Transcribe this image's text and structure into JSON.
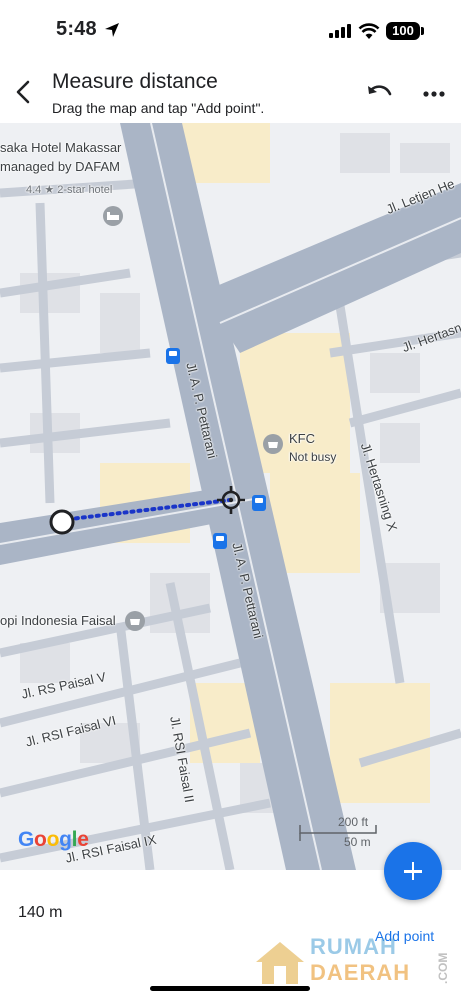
{
  "status_bar": {
    "time": "5:48",
    "battery": "100"
  },
  "header": {
    "title": "Measure distance",
    "subtitle": "Drag the map and tap \"Add point\"."
  },
  "map": {
    "labels": {
      "hotel_line1": "saka Hotel Makassar",
      "hotel_line2": "managed by DAFAM",
      "hotel_rating": "4.4 ★ 2-star hotel",
      "kfc_name": "KFC",
      "kfc_status": "Not busy",
      "kopi": "opi Indonesia Faisal",
      "street_letjen": "Jl. Letjen He",
      "street_hertasning_top": "Jl. Hertasn",
      "street_hertasning_x": "Jl. Hertasning X",
      "street_pettarani_1": "Jl. A. P. Pettarani",
      "street_pettarani_2": "Jl. A. P. Pettarani",
      "street_rs_paisal_v": "Jl. RS Paisal V",
      "street_rsi_faisal_vi": "Jl. RSI Faisal VI",
      "street_rsi_faisal_ii": "Jl. RSI Faisal II",
      "street_rsi_faisal_ix": "Jl. RSI Faisal IX"
    },
    "google_logo": {
      "letters": [
        "G",
        "o",
        "o",
        "g",
        "l",
        "e"
      ],
      "colors": [
        "#4285F4",
        "#EA4335",
        "#FBBC05",
        "#4285F4",
        "#34A853",
        "#EA4335"
      ]
    },
    "scale": {
      "imperial": "200 ft",
      "metric": "50 m"
    },
    "colors": {
      "road": "#aab5c6",
      "block": "#f8ecc9",
      "building": "#dfe1e6",
      "measure_line": "#1a35c8",
      "fab": "#1a73e8"
    }
  },
  "bottom": {
    "distance": "140 m",
    "add_point": "Add point"
  },
  "watermark": {
    "line1": "RUMAH",
    "line2": "DAERAH",
    "suffix": ".COM"
  },
  "icons": [
    "back-arrow-icon",
    "undo-icon",
    "more-vert-icon",
    "crosshair-icon",
    "bus-stop-icon",
    "restaurant-icon",
    "hotel-icon",
    "plus-icon"
  ]
}
